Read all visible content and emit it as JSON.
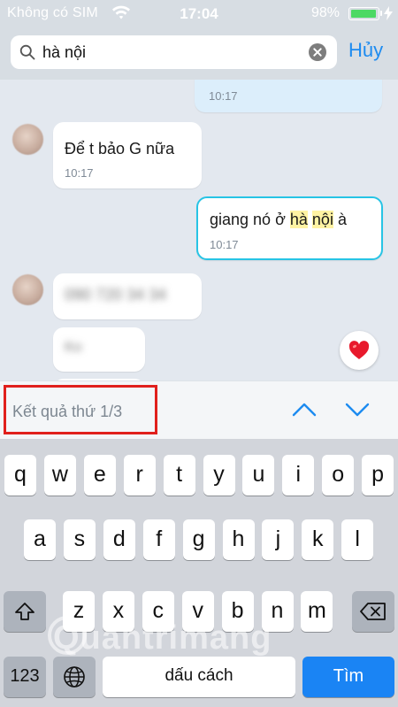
{
  "status_bar": {
    "carrier": "Không có SIM",
    "time": "17:04",
    "battery_percent": "98%",
    "battery_level": 0.98,
    "battery_color": "#4cd964"
  },
  "search": {
    "query": "hà nội",
    "cancel_label": "Hủy",
    "icon": "search-icon",
    "clear_icon": "clear-icon"
  },
  "messages": [
    {
      "direction": "sent",
      "text": "",
      "time": "10:17"
    },
    {
      "direction": "received",
      "text": "Để t bảo G nữa",
      "time": "10:17"
    },
    {
      "direction": "sent",
      "text_before": "giang nó ở ",
      "highlight_1": "hà",
      "highlight_2": "nội",
      "text_after": " à",
      "time": "10:17",
      "matched": true
    },
    {
      "direction": "received",
      "text": "090 720 34 34",
      "blurred": true
    },
    {
      "direction": "received",
      "text": "Ko",
      "blurred": true
    }
  ],
  "reaction_icon": "heart-icon",
  "result_nav": {
    "label": "Kết quả thứ 1/3",
    "up_icon": "chevron-up-icon",
    "down_icon": "chevron-down-icon",
    "accent_color": "#1d8bf0",
    "highlight_color": "#e0201c"
  },
  "keyboard": {
    "row1": [
      "q",
      "w",
      "e",
      "r",
      "t",
      "y",
      "u",
      "i",
      "o",
      "p"
    ],
    "row2": [
      "a",
      "s",
      "d",
      "f",
      "g",
      "h",
      "j",
      "k",
      "l"
    ],
    "row3": [
      "z",
      "x",
      "c",
      "v",
      "b",
      "n",
      "m"
    ],
    "shift_icon": "shift-icon",
    "backspace_icon": "backspace-icon",
    "numbers_label": "123",
    "globe_icon": "globe-icon",
    "space_label": "dấu cách",
    "go_label": "Tìm",
    "go_color": "#1a84f4"
  },
  "watermark": "Quantrimang"
}
